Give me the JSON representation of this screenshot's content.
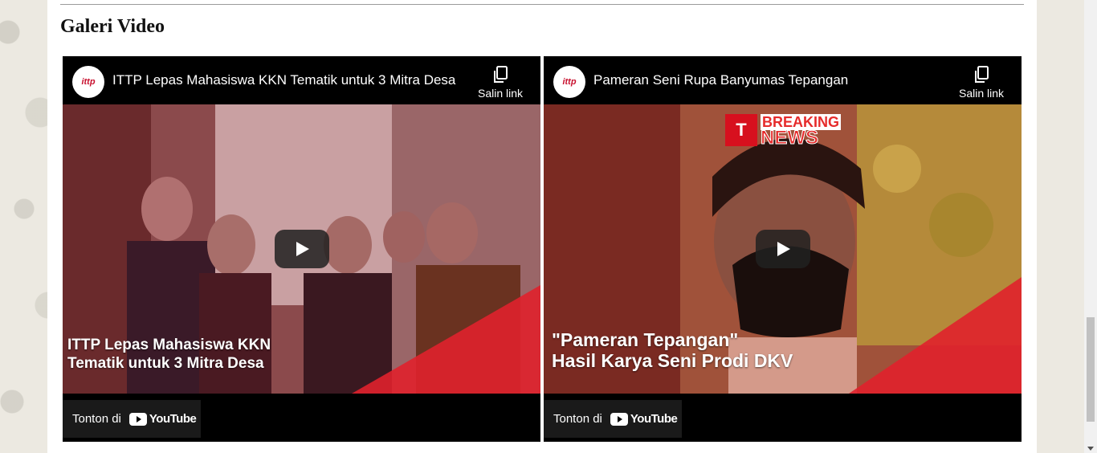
{
  "section": {
    "title": "Galeri Video"
  },
  "videos": [
    {
      "channel": "ittp",
      "title": "ITTP Lepas Mahasiswa KKN Tematik untuk 3 Mitra Desa",
      "copy_label": "Salin link",
      "overlay_line1": "ITTP Lepas Mahasiswa KKN",
      "overlay_line2": "Tematik untuk 3 Mitra Desa",
      "watch_label": "Tonton di",
      "yt_word": "YouTube"
    },
    {
      "channel": "ittp",
      "title": "Pameran Seni Rupa Banyumas Tepangan",
      "copy_label": "Salin link",
      "overlay_line1": "\"Pameran Tepangan\"",
      "overlay_line2": "Hasil Karya Seni Prodi DKV",
      "breaking1": "BREAKING",
      "breaking2": "NEWS",
      "watch_label": "Tonton di",
      "yt_word": "YouTube"
    }
  ],
  "colors": {
    "accent_red": "#d7101e",
    "player_bg": "#000000"
  }
}
